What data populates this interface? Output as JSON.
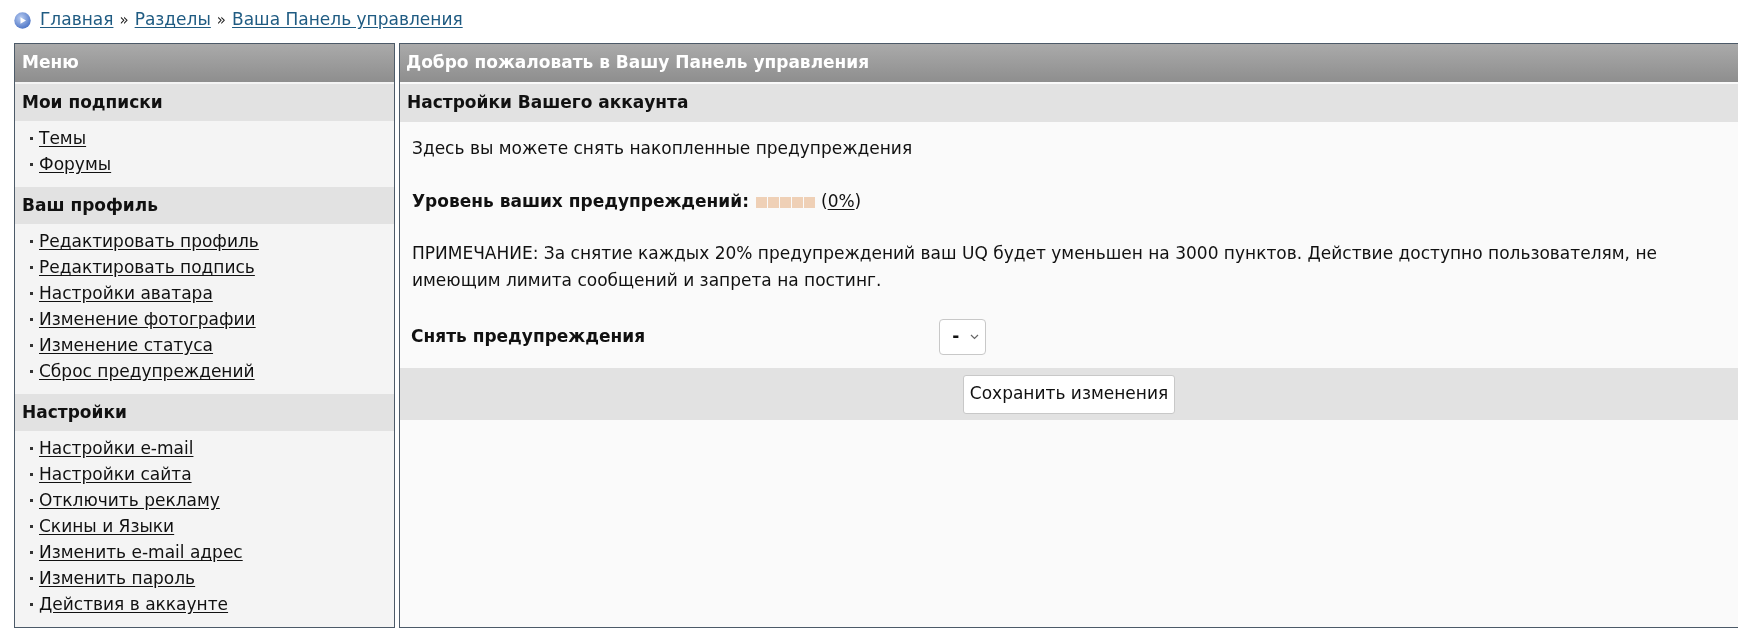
{
  "breadcrumb": [
    {
      "kind": "link",
      "text": "Главная"
    },
    {
      "kind": "separator",
      "text": "»"
    },
    {
      "kind": "link",
      "text": "Разделы"
    },
    {
      "kind": "separator",
      "text": "»"
    },
    {
      "kind": "link",
      "text": "Ваша Панель управления"
    }
  ],
  "sidebar": {
    "title": "Меню",
    "sections": [
      {
        "title": "Мои подписки",
        "items": [
          "Темы",
          "Форумы"
        ]
      },
      {
        "title": "Ваш профиль",
        "items": [
          "Редактировать профиль",
          "Редактировать подпись",
          "Настройки аватара",
          "Изменение фотографии",
          "Изменение статуса",
          "Сброс предупреждений"
        ]
      },
      {
        "title": "Настройки",
        "items": [
          "Настройки e-mail",
          "Настройки сайта",
          "Отключить рекламу",
          "Скины и Языки",
          "Изменить e-mail адрес",
          "Изменить пароль",
          "Действия в аккаунте"
        ]
      }
    ]
  },
  "main": {
    "title": "Добро пожаловать в Вашу Панель управления",
    "subtitle": "Настройки Вашего аккаунта",
    "intro": "Здесь вы можете снять накопленные предупреждения",
    "warning": {
      "label": "Уровень ваших предупреждений:",
      "level": 0,
      "percent_prefix": "(",
      "percent": "0%",
      "percent_suffix": ")"
    },
    "note": "ПРИМЕЧАНИЕ: За снятие каждых 20% предупреждений ваш UQ будет уменьшен на 3000 пунктов. Действие доступно пользователям, не имеющим лимита сообщений и запрета на постинг.",
    "remove_field": {
      "label": "Снять предупреждения",
      "value": "-"
    },
    "save_button": "Сохранить изменения"
  }
}
